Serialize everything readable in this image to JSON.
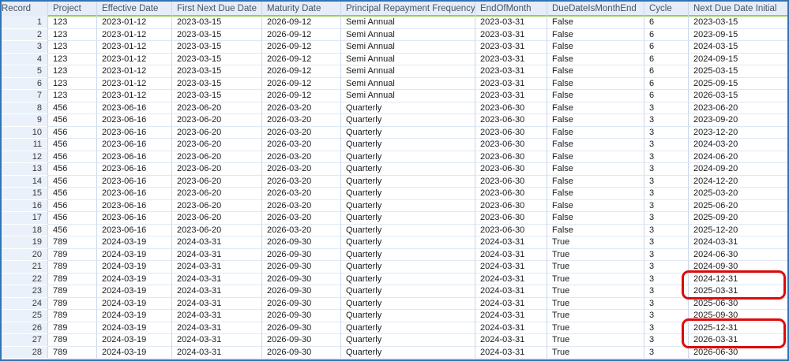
{
  "colors": {
    "border_blue": "#2e74b6",
    "header_green_underline": "#92d050",
    "annotation_red": "#dd0b0b",
    "header_background": "#e7edf6",
    "record_column_background": "#eaf1fa"
  },
  "table": {
    "columns": [
      {
        "key": "record",
        "label": "Record"
      },
      {
        "key": "project",
        "label": "Project"
      },
      {
        "key": "effective-date",
        "label": "Effective Date"
      },
      {
        "key": "first-next-due-date",
        "label": "First Next Due Date"
      },
      {
        "key": "maturity-date",
        "label": "Maturity Date"
      },
      {
        "key": "principal-repayment-frequency",
        "label": "Principal Repayment Frequency"
      },
      {
        "key": "end-of-month",
        "label": "EndOfMonth"
      },
      {
        "key": "due-date-is-month-end",
        "label": "DueDateIsMonthEnd"
      },
      {
        "key": "cycle",
        "label": "Cycle"
      },
      {
        "key": "next-due-date-initial",
        "label": "Next Due Date Initial"
      }
    ],
    "rows": [
      [
        "1",
        "123",
        "2023-01-12",
        "2023-03-15",
        "2026-09-12",
        "Semi Annual",
        "2023-03-31",
        "False",
        "6",
        "2023-03-15"
      ],
      [
        "2",
        "123",
        "2023-01-12",
        "2023-03-15",
        "2026-09-12",
        "Semi Annual",
        "2023-03-31",
        "False",
        "6",
        "2023-09-15"
      ],
      [
        "3",
        "123",
        "2023-01-12",
        "2023-03-15",
        "2026-09-12",
        "Semi Annual",
        "2023-03-31",
        "False",
        "6",
        "2024-03-15"
      ],
      [
        "4",
        "123",
        "2023-01-12",
        "2023-03-15",
        "2026-09-12",
        "Semi Annual",
        "2023-03-31",
        "False",
        "6",
        "2024-09-15"
      ],
      [
        "5",
        "123",
        "2023-01-12",
        "2023-03-15",
        "2026-09-12",
        "Semi Annual",
        "2023-03-31",
        "False",
        "6",
        "2025-03-15"
      ],
      [
        "6",
        "123",
        "2023-01-12",
        "2023-03-15",
        "2026-09-12",
        "Semi Annual",
        "2023-03-31",
        "False",
        "6",
        "2025-09-15"
      ],
      [
        "7",
        "123",
        "2023-01-12",
        "2023-03-15",
        "2026-09-12",
        "Semi Annual",
        "2023-03-31",
        "False",
        "6",
        "2026-03-15"
      ],
      [
        "8",
        "456",
        "2023-06-16",
        "2023-06-20",
        "2026-03-20",
        "Quarterly",
        "2023-06-30",
        "False",
        "3",
        "2023-06-20"
      ],
      [
        "9",
        "456",
        "2023-06-16",
        "2023-06-20",
        "2026-03-20",
        "Quarterly",
        "2023-06-30",
        "False",
        "3",
        "2023-09-20"
      ],
      [
        "10",
        "456",
        "2023-06-16",
        "2023-06-20",
        "2026-03-20",
        "Quarterly",
        "2023-06-30",
        "False",
        "3",
        "2023-12-20"
      ],
      [
        "11",
        "456",
        "2023-06-16",
        "2023-06-20",
        "2026-03-20",
        "Quarterly",
        "2023-06-30",
        "False",
        "3",
        "2024-03-20"
      ],
      [
        "12",
        "456",
        "2023-06-16",
        "2023-06-20",
        "2026-03-20",
        "Quarterly",
        "2023-06-30",
        "False",
        "3",
        "2024-06-20"
      ],
      [
        "13",
        "456",
        "2023-06-16",
        "2023-06-20",
        "2026-03-20",
        "Quarterly",
        "2023-06-30",
        "False",
        "3",
        "2024-09-20"
      ],
      [
        "14",
        "456",
        "2023-06-16",
        "2023-06-20",
        "2026-03-20",
        "Quarterly",
        "2023-06-30",
        "False",
        "3",
        "2024-12-20"
      ],
      [
        "15",
        "456",
        "2023-06-16",
        "2023-06-20",
        "2026-03-20",
        "Quarterly",
        "2023-06-30",
        "False",
        "3",
        "2025-03-20"
      ],
      [
        "16",
        "456",
        "2023-06-16",
        "2023-06-20",
        "2026-03-20",
        "Quarterly",
        "2023-06-30",
        "False",
        "3",
        "2025-06-20"
      ],
      [
        "17",
        "456",
        "2023-06-16",
        "2023-06-20",
        "2026-03-20",
        "Quarterly",
        "2023-06-30",
        "False",
        "3",
        "2025-09-20"
      ],
      [
        "18",
        "456",
        "2023-06-16",
        "2023-06-20",
        "2026-03-20",
        "Quarterly",
        "2023-06-30",
        "False",
        "3",
        "2025-12-20"
      ],
      [
        "19",
        "789",
        "2024-03-19",
        "2024-03-31",
        "2026-09-30",
        "Quarterly",
        "2024-03-31",
        "True",
        "3",
        "2024-03-31"
      ],
      [
        "20",
        "789",
        "2024-03-19",
        "2024-03-31",
        "2026-09-30",
        "Quarterly",
        "2024-03-31",
        "True",
        "3",
        "2024-06-30"
      ],
      [
        "21",
        "789",
        "2024-03-19",
        "2024-03-31",
        "2026-09-30",
        "Quarterly",
        "2024-03-31",
        "True",
        "3",
        "2024-09-30"
      ],
      [
        "22",
        "789",
        "2024-03-19",
        "2024-03-31",
        "2026-09-30",
        "Quarterly",
        "2024-03-31",
        "True",
        "3",
        "2024-12-31"
      ],
      [
        "23",
        "789",
        "2024-03-19",
        "2024-03-31",
        "2026-09-30",
        "Quarterly",
        "2024-03-31",
        "True",
        "3",
        "2025-03-31"
      ],
      [
        "24",
        "789",
        "2024-03-19",
        "2024-03-31",
        "2026-09-30",
        "Quarterly",
        "2024-03-31",
        "True",
        "3",
        "2025-06-30"
      ],
      [
        "25",
        "789",
        "2024-03-19",
        "2024-03-31",
        "2026-09-30",
        "Quarterly",
        "2024-03-31",
        "True",
        "3",
        "2025-09-30"
      ],
      [
        "26",
        "789",
        "2024-03-19",
        "2024-03-31",
        "2026-09-30",
        "Quarterly",
        "2024-03-31",
        "True",
        "3",
        "2025-12-31"
      ],
      [
        "27",
        "789",
        "2024-03-19",
        "2024-03-31",
        "2026-09-30",
        "Quarterly",
        "2024-03-31",
        "True",
        "3",
        "2026-03-31"
      ],
      [
        "28",
        "789",
        "2024-03-19",
        "2024-03-31",
        "2026-09-30",
        "Quarterly",
        "2024-03-31",
        "True",
        "3",
        "2026-06-30"
      ]
    ]
  },
  "annotations": {
    "red_boxes": [
      {
        "column": "Next Due Date Initial",
        "records": [
          "22",
          "23"
        ],
        "values": [
          "2024-12-31",
          "2025-03-31"
        ]
      },
      {
        "column": "Next Due Date Initial",
        "records": [
          "26",
          "27"
        ],
        "values": [
          "2025-12-31",
          "2026-03-31"
        ]
      }
    ]
  }
}
